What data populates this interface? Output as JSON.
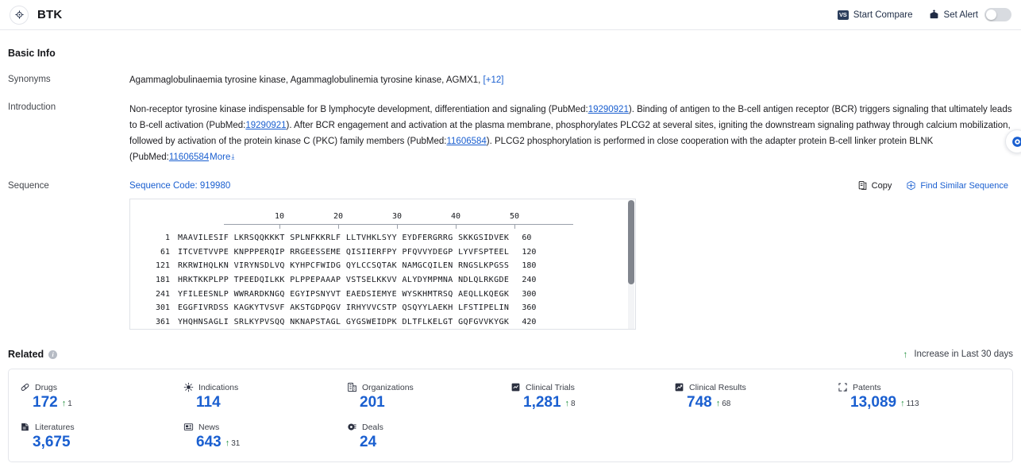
{
  "header": {
    "entity_icon": "target-icon",
    "title": "BTK",
    "start_compare_label": "Start Compare",
    "start_compare_icon": "vs-icon",
    "vs_text": "VS",
    "set_alert_label": "Set Alert",
    "set_alert_icon": "alert-bell-icon",
    "alert_toggle_state": "off"
  },
  "basic_info": {
    "title": "Basic Info",
    "synonyms": {
      "label": "Synonyms",
      "text": "Agammaglobulinaemia tyrosine kinase,  Agammaglobulinemia tyrosine kinase,  AGMX1,",
      "more_count": "[+12]"
    },
    "introduction": {
      "label": "Introduction",
      "part1": "Non-receptor tyrosine kinase indispensable for B lymphocyte development, differentiation and signaling (PubMed:",
      "pubmed1": "19290921",
      "part2": "). Binding of antigen to the B-cell antigen receptor (BCR) triggers signaling that ultimately leads to B-cell activation (PubMed:",
      "pubmed2": "19290921",
      "part3": "). After BCR engagement and activation at the plasma membrane, phosphorylates PLCG2 at several sites, igniting the downstream signaling pathway through calcium mobilization, followed by activation of the protein kinase C (PKC) family members (PubMed:",
      "pubmed3": "11606584",
      "part4": "). PLCG2 phosphorylation is performed in close cooperation with the adapter protein B-cell linker protein BLNK (PubMed:",
      "pubmed4": "11606584",
      "more_label": "More",
      "more_chevron": "chevron-down-icon"
    },
    "sequence": {
      "label": "Sequence",
      "code_label": "Sequence Code: 919980",
      "copy_label": "Copy",
      "copy_icon": "copy-icon",
      "find_similar_label": "Find Similar Sequence",
      "find_similar_icon": "find-similar-icon",
      "ruler_ticks": [
        "10",
        "20",
        "30",
        "40",
        "50"
      ],
      "lines": [
        {
          "start": "1",
          "chunks": "MAAVILESIF LKRSQQKKKT SPLNFKKRLF LLTVHKLSYY EYDFERGRRG SKKGSIDVEK",
          "end": "60"
        },
        {
          "start": "61",
          "chunks": "ITCVETVVPE KNPPPERQIP RRGEESSEME QISIIERFPY PFQVVYDEGP LYVFSPTEEL",
          "end": "120"
        },
        {
          "start": "121",
          "chunks": "RKRWIHQLKN VIRYNSDLVQ KYHPCFWIDG QYLCCSQTAK NAMGCQILEN RNGSLKPGSS",
          "end": "180"
        },
        {
          "start": "181",
          "chunks": "HRKTKKPLPP TPEEDQILKK PLPPEPAAAP VSTSELKKVV ALYDYMPMNA NDLQLRKGDE",
          "end": "240"
        },
        {
          "start": "241",
          "chunks": "YFILEESNLP WWRARDKNGQ EGYIPSNYVT EAEDSIEMYE WYSKHMTRSQ AEQLLKQEGK",
          "end": "300"
        },
        {
          "start": "301",
          "chunks": "EGGFIVRDSS KAGKYTVSVF AKSTGDPQGV IRHYVVCSTP QSQYYLAEKH LFSTIPELIN",
          "end": "360"
        },
        {
          "start": "361",
          "chunks": "YHQHNSAGLI SRLKYPVSQQ NKNAPSTAGL GYGSWEIDPK DLTFLKELGT GQFGVVKYGK",
          "end": "420"
        }
      ]
    }
  },
  "related": {
    "title": "Related",
    "info_icon": "info-icon",
    "increase_note": "Increase in Last 30 days",
    "increase_icon": "up-arrow-icon",
    "stats": [
      {
        "label": "Drugs",
        "icon": "pill-icon",
        "value": "172",
        "delta": "1"
      },
      {
        "label": "Indications",
        "icon": "virus-icon",
        "value": "114",
        "delta": ""
      },
      {
        "label": "Organizations",
        "icon": "building-icon",
        "value": "201",
        "delta": ""
      },
      {
        "label": "Clinical Trials",
        "icon": "clinical-trial-icon",
        "value": "1,281",
        "delta": "8"
      },
      {
        "label": "Clinical Results",
        "icon": "clinical-result-icon",
        "value": "748",
        "delta": "68"
      },
      {
        "label": "Patents",
        "icon": "patent-icon",
        "value": "13,089",
        "delta": "113"
      },
      {
        "label": "Literatures",
        "icon": "literature-icon",
        "value": "3,675",
        "delta": ""
      },
      {
        "label": "News",
        "icon": "news-icon",
        "value": "643",
        "delta": "31"
      },
      {
        "label": "Deals",
        "icon": "deal-icon",
        "value": "24",
        "delta": ""
      }
    ]
  },
  "colors": {
    "accent_blue": "#1a5fd0",
    "increase_green": "#1f8f3c",
    "border": "#e4e6eb"
  }
}
